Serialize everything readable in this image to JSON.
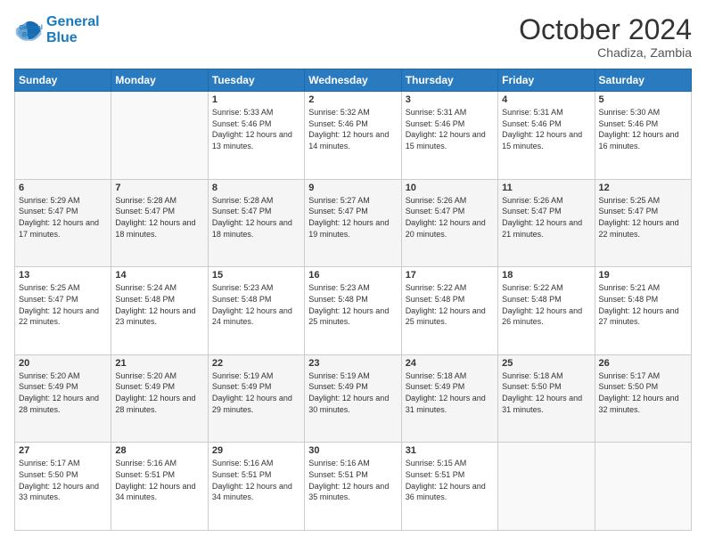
{
  "logo": {
    "line1": "General",
    "line2": "Blue"
  },
  "header": {
    "month": "October 2024",
    "location": "Chadiza, Zambia"
  },
  "days_of_week": [
    "Sunday",
    "Monday",
    "Tuesday",
    "Wednesday",
    "Thursday",
    "Friday",
    "Saturday"
  ],
  "weeks": [
    [
      {
        "day": "",
        "info": ""
      },
      {
        "day": "",
        "info": ""
      },
      {
        "day": "1",
        "sunrise": "Sunrise: 5:33 AM",
        "sunset": "Sunset: 5:46 PM",
        "daylight": "Daylight: 12 hours and 13 minutes."
      },
      {
        "day": "2",
        "sunrise": "Sunrise: 5:32 AM",
        "sunset": "Sunset: 5:46 PM",
        "daylight": "Daylight: 12 hours and 14 minutes."
      },
      {
        "day": "3",
        "sunrise": "Sunrise: 5:31 AM",
        "sunset": "Sunset: 5:46 PM",
        "daylight": "Daylight: 12 hours and 15 minutes."
      },
      {
        "day": "4",
        "sunrise": "Sunrise: 5:31 AM",
        "sunset": "Sunset: 5:46 PM",
        "daylight": "Daylight: 12 hours and 15 minutes."
      },
      {
        "day": "5",
        "sunrise": "Sunrise: 5:30 AM",
        "sunset": "Sunset: 5:46 PM",
        "daylight": "Daylight: 12 hours and 16 minutes."
      }
    ],
    [
      {
        "day": "6",
        "sunrise": "Sunrise: 5:29 AM",
        "sunset": "Sunset: 5:47 PM",
        "daylight": "Daylight: 12 hours and 17 minutes."
      },
      {
        "day": "7",
        "sunrise": "Sunrise: 5:28 AM",
        "sunset": "Sunset: 5:47 PM",
        "daylight": "Daylight: 12 hours and 18 minutes."
      },
      {
        "day": "8",
        "sunrise": "Sunrise: 5:28 AM",
        "sunset": "Sunset: 5:47 PM",
        "daylight": "Daylight: 12 hours and 18 minutes."
      },
      {
        "day": "9",
        "sunrise": "Sunrise: 5:27 AM",
        "sunset": "Sunset: 5:47 PM",
        "daylight": "Daylight: 12 hours and 19 minutes."
      },
      {
        "day": "10",
        "sunrise": "Sunrise: 5:26 AM",
        "sunset": "Sunset: 5:47 PM",
        "daylight": "Daylight: 12 hours and 20 minutes."
      },
      {
        "day": "11",
        "sunrise": "Sunrise: 5:26 AM",
        "sunset": "Sunset: 5:47 PM",
        "daylight": "Daylight: 12 hours and 21 minutes."
      },
      {
        "day": "12",
        "sunrise": "Sunrise: 5:25 AM",
        "sunset": "Sunset: 5:47 PM",
        "daylight": "Daylight: 12 hours and 22 minutes."
      }
    ],
    [
      {
        "day": "13",
        "sunrise": "Sunrise: 5:25 AM",
        "sunset": "Sunset: 5:47 PM",
        "daylight": "Daylight: 12 hours and 22 minutes."
      },
      {
        "day": "14",
        "sunrise": "Sunrise: 5:24 AM",
        "sunset": "Sunset: 5:48 PM",
        "daylight": "Daylight: 12 hours and 23 minutes."
      },
      {
        "day": "15",
        "sunrise": "Sunrise: 5:23 AM",
        "sunset": "Sunset: 5:48 PM",
        "daylight": "Daylight: 12 hours and 24 minutes."
      },
      {
        "day": "16",
        "sunrise": "Sunrise: 5:23 AM",
        "sunset": "Sunset: 5:48 PM",
        "daylight": "Daylight: 12 hours and 25 minutes."
      },
      {
        "day": "17",
        "sunrise": "Sunrise: 5:22 AM",
        "sunset": "Sunset: 5:48 PM",
        "daylight": "Daylight: 12 hours and 25 minutes."
      },
      {
        "day": "18",
        "sunrise": "Sunrise: 5:22 AM",
        "sunset": "Sunset: 5:48 PM",
        "daylight": "Daylight: 12 hours and 26 minutes."
      },
      {
        "day": "19",
        "sunrise": "Sunrise: 5:21 AM",
        "sunset": "Sunset: 5:48 PM",
        "daylight": "Daylight: 12 hours and 27 minutes."
      }
    ],
    [
      {
        "day": "20",
        "sunrise": "Sunrise: 5:20 AM",
        "sunset": "Sunset: 5:49 PM",
        "daylight": "Daylight: 12 hours and 28 minutes."
      },
      {
        "day": "21",
        "sunrise": "Sunrise: 5:20 AM",
        "sunset": "Sunset: 5:49 PM",
        "daylight": "Daylight: 12 hours and 28 minutes."
      },
      {
        "day": "22",
        "sunrise": "Sunrise: 5:19 AM",
        "sunset": "Sunset: 5:49 PM",
        "daylight": "Daylight: 12 hours and 29 minutes."
      },
      {
        "day": "23",
        "sunrise": "Sunrise: 5:19 AM",
        "sunset": "Sunset: 5:49 PM",
        "daylight": "Daylight: 12 hours and 30 minutes."
      },
      {
        "day": "24",
        "sunrise": "Sunrise: 5:18 AM",
        "sunset": "Sunset: 5:49 PM",
        "daylight": "Daylight: 12 hours and 31 minutes."
      },
      {
        "day": "25",
        "sunrise": "Sunrise: 5:18 AM",
        "sunset": "Sunset: 5:50 PM",
        "daylight": "Daylight: 12 hours and 31 minutes."
      },
      {
        "day": "26",
        "sunrise": "Sunrise: 5:17 AM",
        "sunset": "Sunset: 5:50 PM",
        "daylight": "Daylight: 12 hours and 32 minutes."
      }
    ],
    [
      {
        "day": "27",
        "sunrise": "Sunrise: 5:17 AM",
        "sunset": "Sunset: 5:50 PM",
        "daylight": "Daylight: 12 hours and 33 minutes."
      },
      {
        "day": "28",
        "sunrise": "Sunrise: 5:16 AM",
        "sunset": "Sunset: 5:51 PM",
        "daylight": "Daylight: 12 hours and 34 minutes."
      },
      {
        "day": "29",
        "sunrise": "Sunrise: 5:16 AM",
        "sunset": "Sunset: 5:51 PM",
        "daylight": "Daylight: 12 hours and 34 minutes."
      },
      {
        "day": "30",
        "sunrise": "Sunrise: 5:16 AM",
        "sunset": "Sunset: 5:51 PM",
        "daylight": "Daylight: 12 hours and 35 minutes."
      },
      {
        "day": "31",
        "sunrise": "Sunrise: 5:15 AM",
        "sunset": "Sunset: 5:51 PM",
        "daylight": "Daylight: 12 hours and 36 minutes."
      },
      {
        "day": "",
        "info": ""
      },
      {
        "day": "",
        "info": ""
      }
    ]
  ]
}
